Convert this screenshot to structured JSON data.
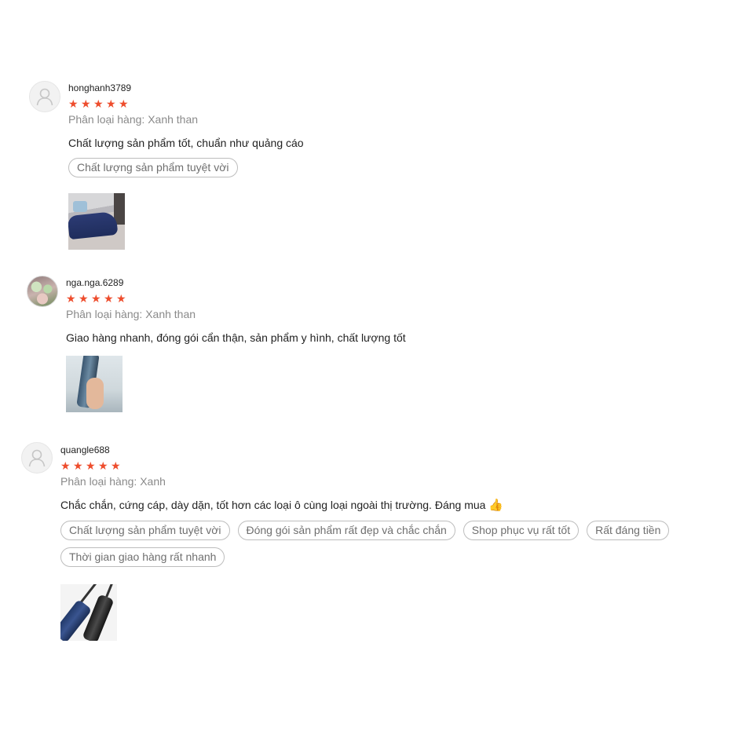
{
  "reviews": [
    {
      "username": "honghanh3789",
      "rating": 5,
      "variation": "Phân loại hàng: Xanh than",
      "comment": "Chất lượng sản phẩm tốt, chuẩn như quảng cáo",
      "tags": [
        "Chất lượng sản phẩm tuyệt vời"
      ]
    },
    {
      "username": "nga.nga.6289",
      "rating": 5,
      "variation": "Phân loại hàng: Xanh than",
      "comment": "Giao hàng nhanh, đóng gói cẩn thận, sản phẩm y hình, chất lượng tốt",
      "tags": []
    },
    {
      "username": "quangle688",
      "rating": 5,
      "variation": "Phân loại hàng: Xanh",
      "comment": "Chắc chắn, cứng cáp, dày dặn, tốt hơn các loại ô cùng loại ngoài thị trường. Đáng mua",
      "comment_emoji": "👍",
      "tags": [
        "Chất lượng sản phẩm tuyệt vời",
        "Đóng gói sản phẩm rất đẹp và chắc chắn",
        "Shop phục vụ rất tốt",
        "Rất đáng tiền",
        "Thời gian giao hàng rất nhanh"
      ]
    }
  ],
  "colors": {
    "star": "#ee4d2d",
    "muted": "#8a8a8a",
    "tag_border": "#bdbdbd"
  }
}
